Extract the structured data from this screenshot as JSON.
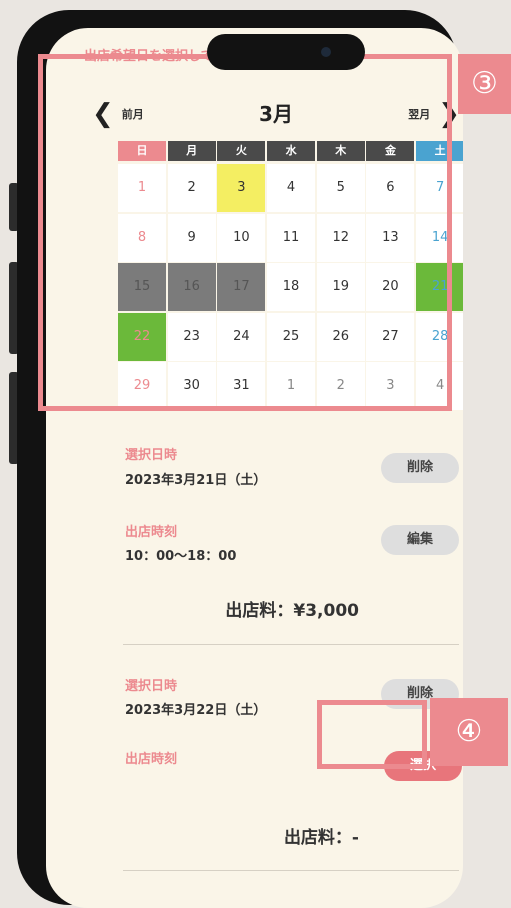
{
  "header": {
    "note": "出店希望日を選択してください（複数選択可）"
  },
  "calendar": {
    "month": "3月",
    "prev_label": "前月",
    "next_label": "翌月",
    "weekdays": [
      "日",
      "月",
      "火",
      "水",
      "木",
      "金",
      "土"
    ],
    "weeks": [
      [
        "1",
        "2",
        "3",
        "4",
        "5",
        "6",
        "7"
      ],
      [
        "8",
        "9",
        "10",
        "11",
        "12",
        "13",
        "14"
      ],
      [
        "15",
        "16",
        "17",
        "18",
        "19",
        "20",
        "21"
      ],
      [
        "22",
        "23",
        "24",
        "25",
        "26",
        "27",
        "28"
      ],
      [
        "29",
        "30",
        "31",
        "1",
        "2",
        "3",
        "4"
      ]
    ],
    "today": "3",
    "disabled_days": [
      "15",
      "16",
      "17"
    ],
    "selected_days": [
      "21",
      "22"
    ]
  },
  "annotations": {
    "step3": "③",
    "step4": "④"
  },
  "entries": [
    {
      "date_label": "選択日時",
      "date_value": "2023年3月21日（土）",
      "delete_label": "削除",
      "time_label": "出店時刻",
      "time_value": "10：00〜18：00",
      "time_action_label": "編集",
      "fee": "出店料：¥3,000"
    },
    {
      "date_label": "選択日時",
      "date_value": "2023年3月22日（土）",
      "delete_label": "削除",
      "time_label": "出店時刻",
      "time_action_label": "選択",
      "fee": "出店料：-"
    }
  ],
  "colors": {
    "accent": "#ec8a8f",
    "saturday": "#4aa3d0",
    "selected": "#6bb93a",
    "today": "#f4ee62",
    "disabled": "#7b7b7b"
  }
}
